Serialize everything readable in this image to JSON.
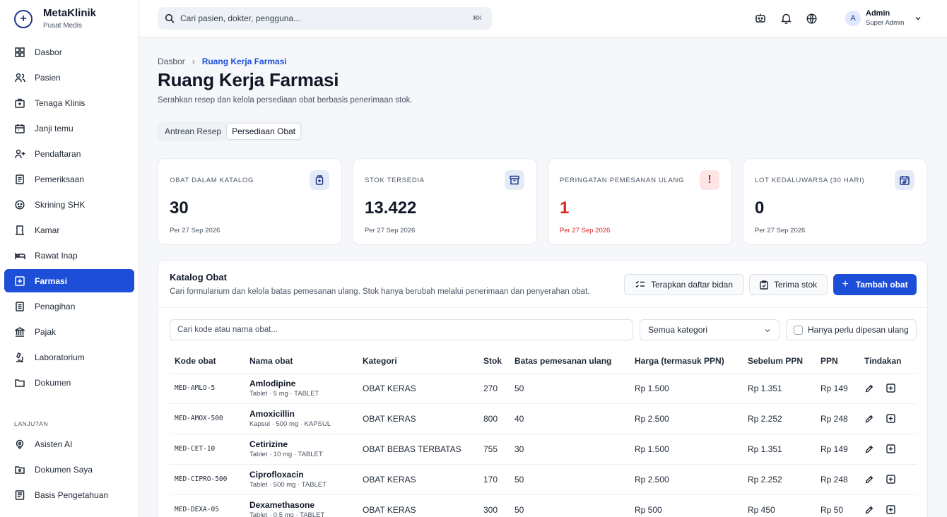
{
  "brand": {
    "name": "MetaKlinik",
    "subtitle": "Pusat Medis"
  },
  "sidebar": {
    "items": [
      {
        "label": "Dasbor",
        "icon": "dashboard-icon"
      },
      {
        "label": "Pasien",
        "icon": "users-icon"
      },
      {
        "label": "Tenaga Klinis",
        "icon": "medical-bag-icon"
      },
      {
        "label": "Janji temu",
        "icon": "calendar-icon"
      },
      {
        "label": "Pendaftaran",
        "icon": "user-plus-icon"
      },
      {
        "label": "Pemeriksaan",
        "icon": "clipboard-icon"
      },
      {
        "label": "Skrining SHK",
        "icon": "screening-icon"
      },
      {
        "label": "Kamar",
        "icon": "door-icon"
      },
      {
        "label": "Rawat Inap",
        "icon": "bed-icon"
      },
      {
        "label": "Farmasi",
        "icon": "pharmacy-icon",
        "active": true
      },
      {
        "label": "Penagihan",
        "icon": "billing-icon"
      },
      {
        "label": "Pajak",
        "icon": "bank-icon"
      },
      {
        "label": "Laboratorium",
        "icon": "microscope-icon"
      },
      {
        "label": "Dokumen",
        "icon": "folder-icon"
      }
    ],
    "section_label": "LANJUTAN",
    "advanced_items": [
      {
        "label": "Asisten AI",
        "icon": "ai-icon"
      },
      {
        "label": "Dokumen Saya",
        "icon": "my-documents-icon"
      },
      {
        "label": "Basis Pengetahuan",
        "icon": "knowledge-base-icon"
      }
    ]
  },
  "topbar": {
    "search_placeholder": "Cari pasien, dokter, pengguna...",
    "shortcut": "⌘K",
    "user": {
      "initial": "A",
      "name": "Admin",
      "role": "Super Admin"
    }
  },
  "header": {
    "breadcrumb_root": "Dasbor",
    "breadcrumb_separator": "›",
    "breadcrumb_current": "Ruang Kerja Farmasi",
    "title": "Ruang Kerja Farmasi",
    "subtitle": "Serahkan resep dan kelola persediaan obat berbasis penerimaan stok."
  },
  "tabs": [
    {
      "label": "Antrean Resep",
      "active": false
    },
    {
      "label": "Persediaan Obat",
      "active": true
    }
  ],
  "stats": [
    {
      "label": "OBAT DALAM KATALOG",
      "value": "30",
      "footer": "Per 27 Sep 2026",
      "icon": "pill-box-icon"
    },
    {
      "label": "STOK TERSEDIA",
      "value": "13.422",
      "footer": "Per 27 Sep 2026",
      "icon": "archive-icon"
    },
    {
      "label": "PERINGATAN PEMESANAN ULANG",
      "value": "1",
      "footer": "Per 27 Sep 2026",
      "icon": "alert-icon",
      "icon_glyph": "!"
    },
    {
      "label": "LOT KEDALUWARSA (30 HARI)",
      "value": "0",
      "footer": "Per 27 Sep 2026",
      "icon": "calendar-expiry-icon"
    }
  ],
  "catalog": {
    "title": "Katalog Obat",
    "subtitle": "Cari formularium dan kelola batas pemesanan ulang. Stok hanya berubah melalui penerimaan dan penyerahan obat.",
    "buttons": {
      "apply_midwife": "Terapkan daftar bidan",
      "receive_stock": "Terima stok",
      "add_drug": "Tambah obat",
      "add_glyph": "+"
    },
    "filters": {
      "search_placeholder": "Cari kode atau nama obat...",
      "category_value": "Semua kategori",
      "reorder_only_label": "Hanya perlu dipesan ulang"
    },
    "columns": [
      "Kode obat",
      "Nama obat",
      "Kategori",
      "Stok",
      "Batas pemesanan ulang",
      "Harga (termasuk PPN)",
      "Sebelum PPN",
      "PPN",
      "Tindakan"
    ],
    "rows": [
      {
        "code": "MED-AMLO-5",
        "name": "Amlodipine",
        "desc": "Tablet · 5 mg · TABLET",
        "category": "OBAT KERAS",
        "stock": "270",
        "reorder": "50",
        "price": "Rp 1.500",
        "before_tax": "Rp 1.351",
        "tax": "Rp 149"
      },
      {
        "code": "MED-AMOX-500",
        "name": "Amoxicillin",
        "desc": "Kapsul · 500 mg · KAPSUL",
        "category": "OBAT KERAS",
        "stock": "800",
        "reorder": "40",
        "price": "Rp 2.500",
        "before_tax": "Rp 2.252",
        "tax": "Rp 248"
      },
      {
        "code": "MED-CET-10",
        "name": "Cetirizine",
        "desc": "Tablet · 10 mg · TABLET",
        "category": "OBAT BEBAS TERBATAS",
        "stock": "755",
        "reorder": "30",
        "price": "Rp 1.500",
        "before_tax": "Rp 1.351",
        "tax": "Rp 149"
      },
      {
        "code": "MED-CIPRO-500",
        "name": "Ciprofloxacin",
        "desc": "Tablet · 500 mg · TABLET",
        "category": "OBAT KERAS",
        "stock": "170",
        "reorder": "50",
        "price": "Rp 2.500",
        "before_tax": "Rp 2.252",
        "tax": "Rp 248"
      },
      {
        "code": "MED-DEXA-05",
        "name": "Dexamethasone",
        "desc": "Tablet · 0.5 mg · TABLET",
        "category": "OBAT KERAS",
        "stock": "300",
        "reorder": "50",
        "price": "Rp 500",
        "before_tax": "Rp 450",
        "tax": "Rp 50"
      }
    ]
  },
  "colors": {
    "primary": "#1d4ed8",
    "danger": "#dc2626",
    "background": "#f5f7fa"
  }
}
